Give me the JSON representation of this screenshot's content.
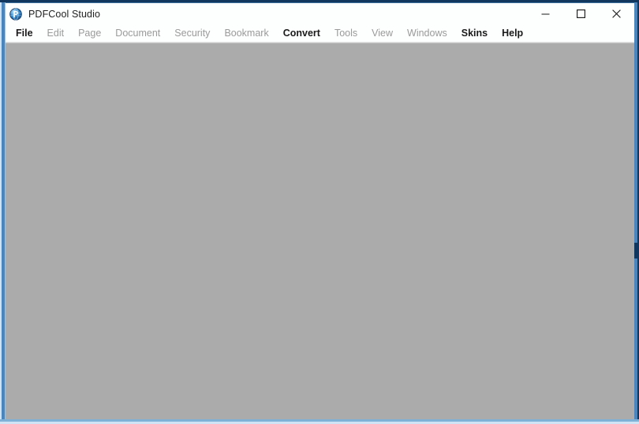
{
  "window": {
    "title": "PDFCool Studio",
    "app_icon": "pdfcool-app-icon",
    "border_color": "#4a86bd",
    "border_top_color": "#12375f",
    "titlebar_bg": "#fdfefe",
    "content_bg": "#ababab"
  },
  "window_controls": {
    "minimize": {
      "label": "Minimize",
      "icon": "minimize-icon"
    },
    "maximize": {
      "label": "Maximize",
      "icon": "maximize-icon"
    },
    "close": {
      "label": "Close",
      "icon": "close-icon"
    }
  },
  "menu_bar": {
    "items": [
      {
        "label": "File",
        "name": "file",
        "enabled": true
      },
      {
        "label": "Edit",
        "name": "edit",
        "enabled": false
      },
      {
        "label": "Page",
        "name": "page",
        "enabled": false
      },
      {
        "label": "Document",
        "name": "document",
        "enabled": false
      },
      {
        "label": "Security",
        "name": "security",
        "enabled": false
      },
      {
        "label": "Bookmark",
        "name": "bookmark",
        "enabled": false
      },
      {
        "label": "Convert",
        "name": "convert",
        "enabled": true
      },
      {
        "label": "Tools",
        "name": "tools",
        "enabled": false
      },
      {
        "label": "View",
        "name": "view",
        "enabled": false
      },
      {
        "label": "Windows",
        "name": "windows",
        "enabled": false
      },
      {
        "label": "Skins",
        "name": "skins",
        "enabled": true
      },
      {
        "label": "Help",
        "name": "help",
        "enabled": true
      }
    ]
  },
  "content": {
    "empty": true,
    "text": ""
  }
}
